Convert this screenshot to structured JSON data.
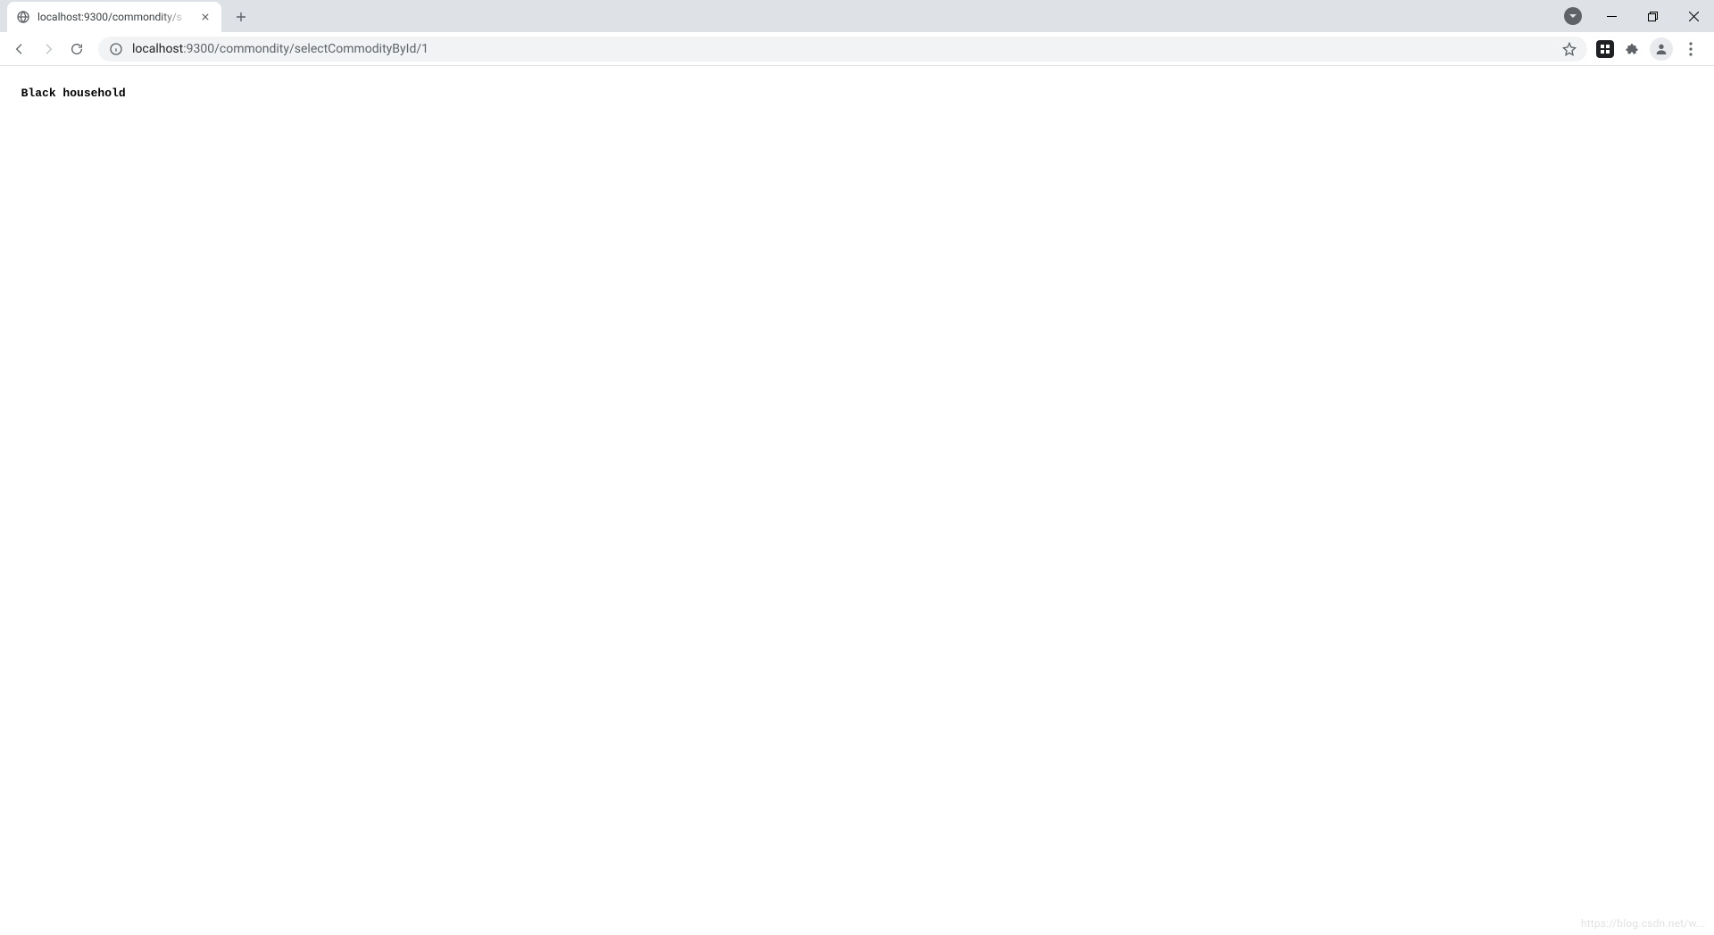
{
  "browser": {
    "tab": {
      "title": "localhost:9300/commondity/s",
      "favicon": "globe-icon"
    },
    "url": {
      "host": "localhost",
      "port": ":9300",
      "path": "/commondity/selectCommodityById/1"
    }
  },
  "page": {
    "body_text": "Black household"
  },
  "watermark": "https://blog.csdn.net/w..."
}
